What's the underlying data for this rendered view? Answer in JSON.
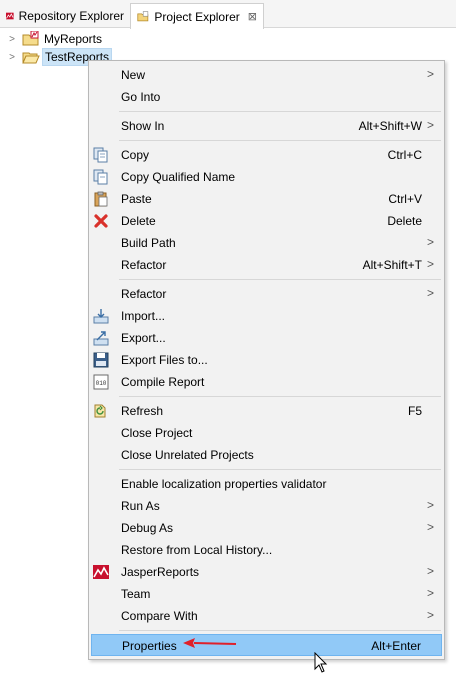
{
  "tabs": [
    {
      "label": "Repository Explorer",
      "icon": "jasper-logo-icon"
    },
    {
      "label": "Project Explorer",
      "icon": "project-explorer-icon",
      "close": "⊠"
    }
  ],
  "tree": [
    {
      "label": "MyReports",
      "icon": "project-folder-icon",
      "expander": ">"
    },
    {
      "label": "TestReports",
      "icon": "project-folder-open-icon",
      "expander": ">"
    }
  ],
  "menu": {
    "items": [
      {
        "label": "New",
        "submenu": ">"
      },
      {
        "label": "Go Into"
      },
      {
        "label": "Show In",
        "shortcut": "Alt+Shift+W",
        "submenu": ">"
      },
      {
        "label": "Copy",
        "shortcut": "Ctrl+C",
        "icon": "copy-icon"
      },
      {
        "label": "Copy Qualified Name",
        "icon": "copy-qualified-name-icon"
      },
      {
        "label": "Paste",
        "shortcut": "Ctrl+V",
        "icon": "paste-icon"
      },
      {
        "label": "Delete",
        "shortcut": "Delete",
        "icon": "delete-icon"
      },
      {
        "label": "Build Path",
        "submenu": ">"
      },
      {
        "label": "Refactor",
        "shortcut": "Alt+Shift+T",
        "submenu": ">"
      },
      {
        "label": "Refactor",
        "submenu": ">"
      },
      {
        "label": "Import...",
        "icon": "import-icon"
      },
      {
        "label": "Export...",
        "icon": "export-icon"
      },
      {
        "label": "Export Files to...",
        "icon": "save-disk-icon"
      },
      {
        "label": "Compile Report",
        "icon": "compile-icon"
      },
      {
        "label": "Refresh",
        "shortcut": "F5",
        "icon": "refresh-icon"
      },
      {
        "label": "Close Project"
      },
      {
        "label": "Close Unrelated Projects"
      },
      {
        "label": "Enable localization properties validator"
      },
      {
        "label": "Run As",
        "submenu": ">"
      },
      {
        "label": "Debug As",
        "submenu": ">"
      },
      {
        "label": "Restore from Local History..."
      },
      {
        "label": "JasperReports",
        "submenu": ">",
        "icon": "jasper-logo-icon"
      },
      {
        "label": "Team",
        "submenu": ">"
      },
      {
        "label": "Compare With",
        "submenu": ">"
      },
      {
        "label": "Properties",
        "shortcut": "Alt+Enter"
      }
    ]
  },
  "colors": {
    "highlight": "#91c9f7",
    "menu_bg": "#f2f2f2",
    "selection": "#cce4f7",
    "annotation_arrow": "#e0202a",
    "jasper_red": "#c8102e"
  }
}
